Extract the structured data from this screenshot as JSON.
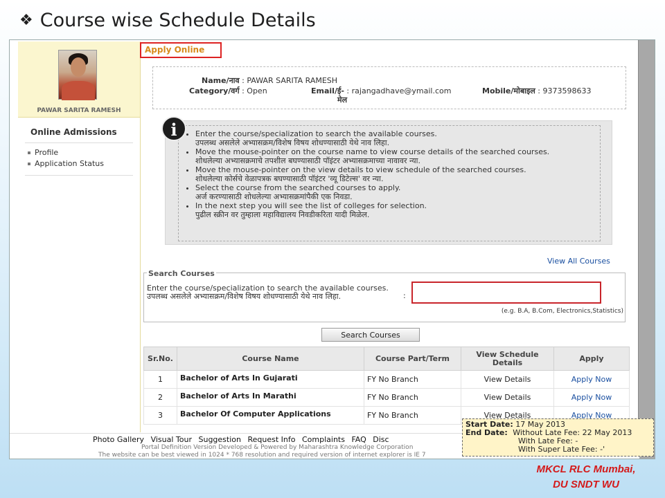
{
  "slide": {
    "title": "Course wise Schedule Details",
    "credit_line1": "MKCL RLC Mumbai,",
    "credit_line2": "DU SNDT WU"
  },
  "sidebar": {
    "profile_name": "PAWAR SARITA RAMESH",
    "heading": "Online Admissions",
    "links": [
      "Profile",
      "Application Status"
    ]
  },
  "page": {
    "apply_online": "Apply Online"
  },
  "applicant": {
    "name_label": "Name/नाव",
    "name_value": "PAWAR SARITA RAMESH",
    "category_label": "Category/वर्ग",
    "category_value": "Open",
    "email_label": "Email/ई-",
    "email_label2": "मेल",
    "email_value": "rajangadhave@ymail.com",
    "mobile_label": "Mobile/मोबाइल",
    "mobile_value": "9373598633"
  },
  "instructions": [
    [
      "Enter the course/specialization to search the available courses.",
      "उपलब्ध असलेले अभ्यासक्रम/विशेष विषय शोधण्यासाठी येथे नाव लिहा."
    ],
    [
      "Move the mouse-pointer on the course name to view course details of the searched courses.",
      "शोधलेल्या अभ्यासक्रमाचे तपशील बघण्यासाठी पॉइंटर अभ्यासक्रमाच्या नावावर न्या."
    ],
    [
      "Move the mouse-pointer on the view details to view schedule of the searched courses.",
      "शोधलेल्या कोर्सचे वेळापत्रक बघण्यासाठी पॉइंटर 'व्यू डिटेल्स' वर न्या."
    ],
    [
      "Select the course from the searched courses to apply.",
      "अर्ज करण्यासाठी शोधलेल्या अभ्यासक्रमांपैकी एक निवडा."
    ],
    [
      "In the next step you will see the list of colleges for selection.",
      "पुढील स्क्रीन वर तुम्हाला महाविद्यालय निवडीकरिता यादी मिळेल."
    ]
  ],
  "search": {
    "view_all": "View All Courses",
    "legend": "Search Courses",
    "text_en": "Enter the course/specialization to search the available courses.",
    "text_mr": "उपलब्ध असलेले अभ्यासक्रम/विशेष विषय शोधण्यासाठी येथे नाव लिहा.",
    "colon": ":",
    "input_value": "",
    "hint": "(e.g. B.A, B.Com, Electronics,Statistics)",
    "button": "Search Courses"
  },
  "table": {
    "headers": [
      "Sr.No.",
      "Course Name",
      "Course Part/Term",
      "View Schedule Details",
      "Apply"
    ],
    "rows": [
      {
        "sr": "1",
        "name": "Bachelor of Arts In Gujarati",
        "part": "FY No Branch",
        "view": "View Details",
        "apply": "Apply Now"
      },
      {
        "sr": "2",
        "name": "Bachelor of Arts In Marathi",
        "part": "FY No Branch",
        "view": "View Details",
        "apply": "Apply Now"
      },
      {
        "sr": "3",
        "name": "Bachelor Of Computer Applications",
        "part": "FY No Branch",
        "view": "View Details",
        "apply": "Apply Now"
      }
    ]
  },
  "footer": {
    "links": [
      "Photo Gallery",
      "Visual Tour",
      "Suggestion",
      "Request Info",
      "Complaints",
      "FAQ",
      "Disc"
    ],
    "line1": "Portal Definition Version        Developed & Powered by Maharashtra Knowledge Corporation",
    "line2": "The website can be best viewed in 1024 * 768 resolution and required version of internet explorer is IE 7"
  },
  "tooltip": {
    "start_label": "Start Date:",
    "start_value": "17 May 2013",
    "end_label": "End Date:",
    "end_value": "Without Late Fee: 22 May 2013",
    "late_fee": "With Late Fee: -",
    "super_late_fee": "With Super Late Fee: -'"
  }
}
